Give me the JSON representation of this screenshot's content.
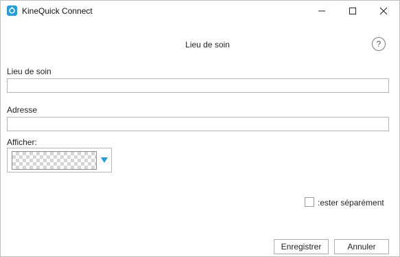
{
  "window": {
    "title": "KineQuick Connect",
    "accent_color": "#1ba1e2"
  },
  "header": {
    "title": "Lieu de soin",
    "help_label": "?"
  },
  "form": {
    "lieu": {
      "label": "Lieu de soin",
      "value": ""
    },
    "adresse": {
      "label": "Adresse",
      "value": ""
    },
    "afficher": {
      "label": "Afficher:",
      "selected": "transparent-swatch"
    },
    "separate": {
      "label": ":ester séparément",
      "checked": false
    }
  },
  "buttons": {
    "save": "Enregistrer",
    "cancel": "Annuler"
  },
  "icons": {
    "app": "kinequick-app-icon",
    "minimize": "minimize-icon",
    "maximize": "maximize-icon",
    "close": "close-icon",
    "help": "help-icon",
    "dropdown": "dropdown-triangle-icon"
  }
}
